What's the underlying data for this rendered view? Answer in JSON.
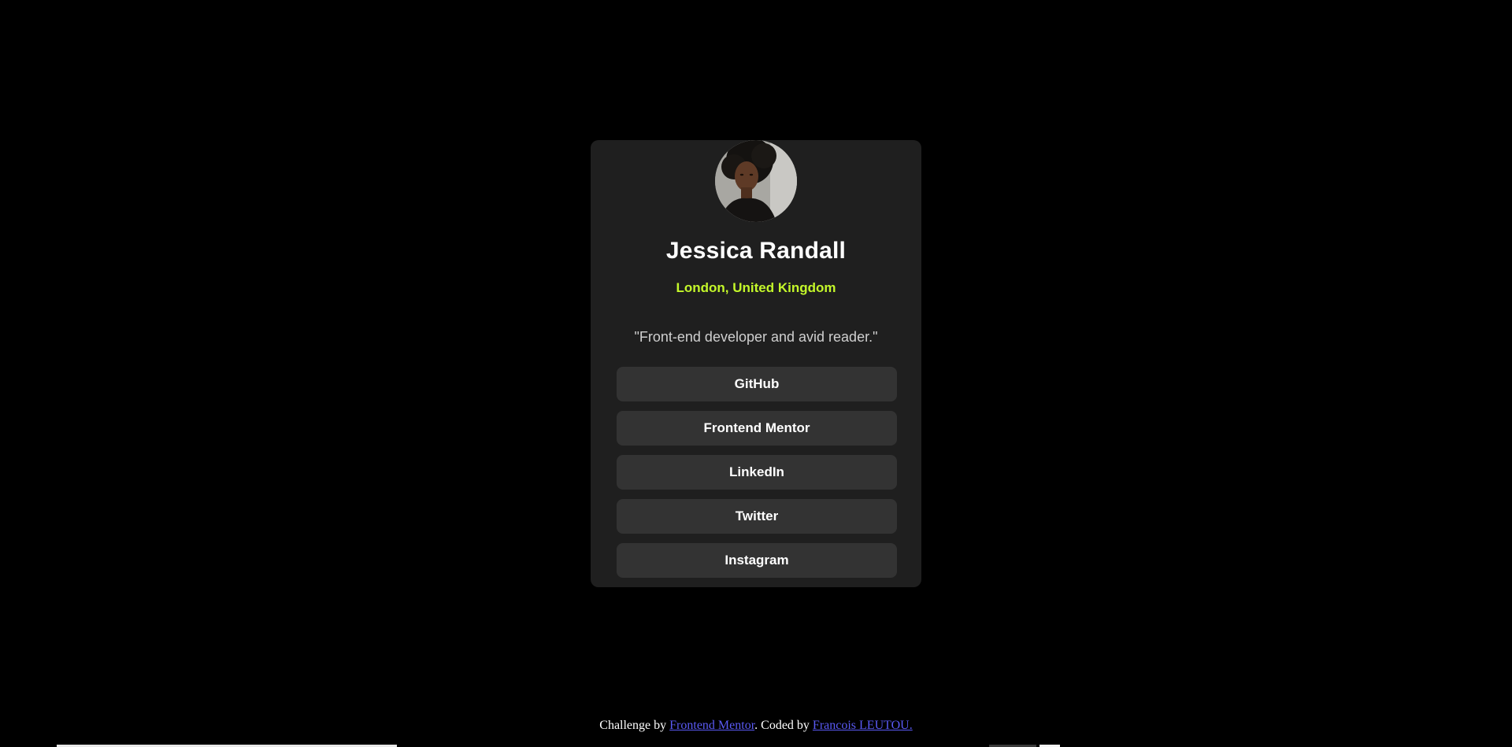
{
  "profile": {
    "name": "Jessica Randall",
    "location": "London, United Kingdom",
    "bio": "\"Front-end developer and avid reader.\""
  },
  "links": [
    {
      "label": "GitHub"
    },
    {
      "label": "Frontend Mentor"
    },
    {
      "label": "LinkedIn"
    },
    {
      "label": "Twitter"
    },
    {
      "label": "Instagram"
    }
  ],
  "footer": {
    "prefix": "Challenge by ",
    "challenge_link": "Frontend Mentor",
    "middle": ". Coded by ",
    "author_link": "Francois LEUTOU."
  },
  "colors": {
    "background": "#000000",
    "card": "#1f1f1f",
    "button": "#333333",
    "accent": "#c4f82a",
    "text": "#ffffff",
    "link": "#5a5af5"
  }
}
